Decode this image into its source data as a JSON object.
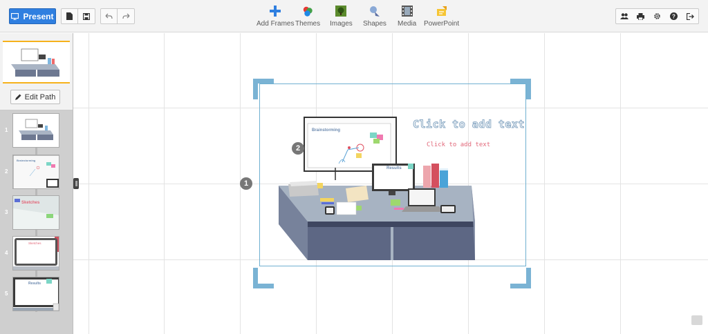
{
  "toolbar": {
    "present_label": "Present",
    "inserts": [
      {
        "label": "Add Frames",
        "icon": "add-frames-icon"
      },
      {
        "label": "Themes",
        "icon": "themes-icon"
      },
      {
        "label": "Images",
        "icon": "images-icon"
      },
      {
        "label": "Shapes",
        "icon": "shapes-icon"
      },
      {
        "label": "Media",
        "icon": "media-icon"
      },
      {
        "label": "PowerPoint",
        "icon": "powerpoint-icon"
      }
    ],
    "right_icons": [
      "share-icon",
      "print-icon",
      "settings-icon",
      "help-icon",
      "exit-icon"
    ]
  },
  "sidebar": {
    "edit_path_label": "Edit Path",
    "slides": [
      {
        "number": "1"
      },
      {
        "number": "2",
        "label": "Brainstorming"
      },
      {
        "number": "3",
        "label": "Sketches"
      },
      {
        "number": "4",
        "label": "Sketches"
      },
      {
        "number": "5",
        "label": "Results"
      }
    ]
  },
  "canvas": {
    "path_badges": [
      "1",
      "2"
    ],
    "title_placeholder": "Click to add text",
    "subtitle_placeholder": "Click to add text",
    "whiteboard_title": "Brainstorming",
    "monitor_title": "Results"
  },
  "colors": {
    "accent": "#2f7fe0",
    "frame_corner": "#7ab3d4",
    "selected_border": "#f6b11b"
  }
}
